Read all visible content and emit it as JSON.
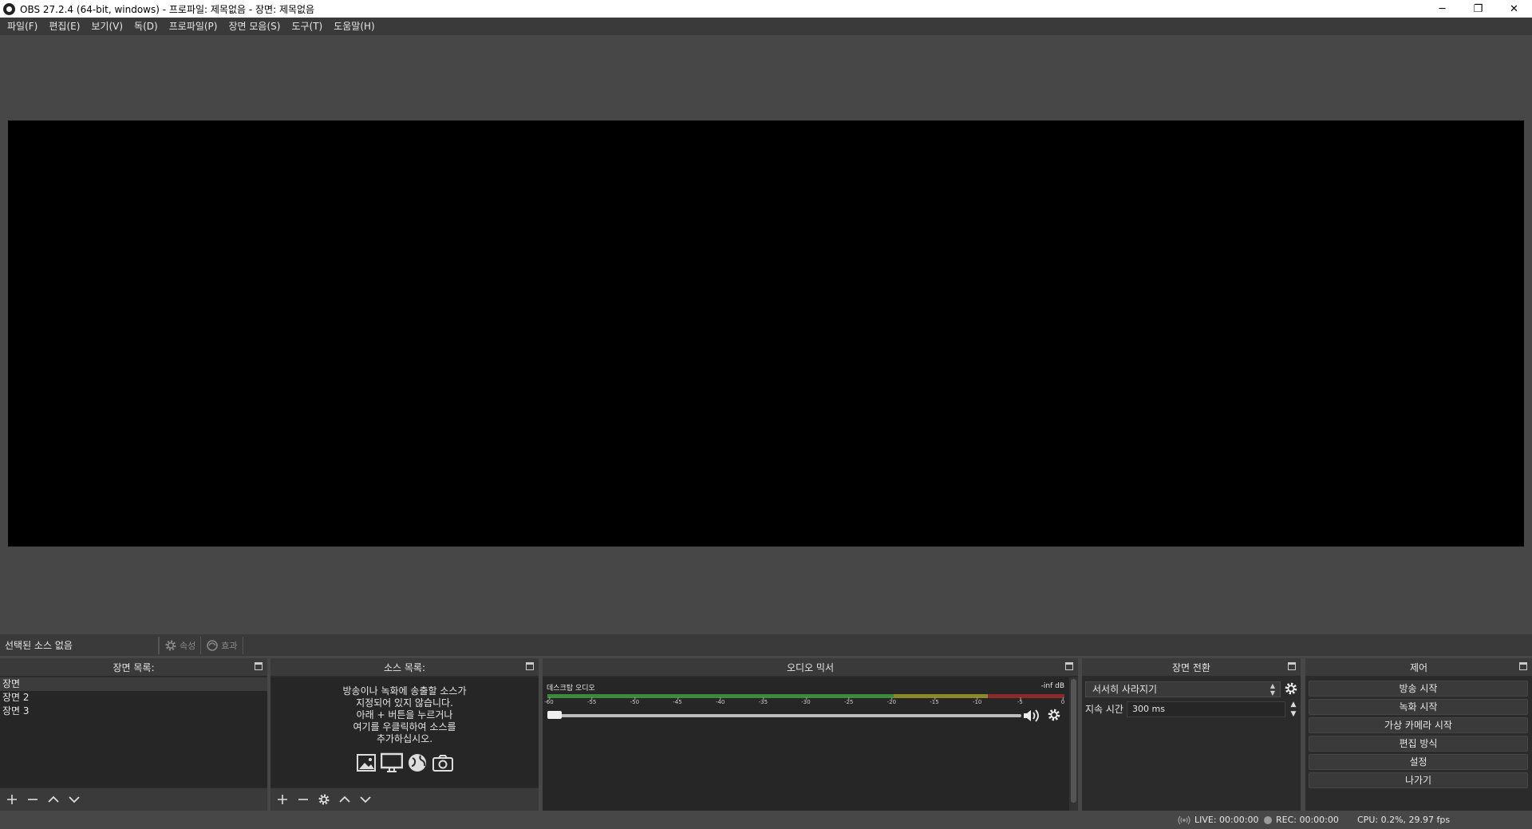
{
  "window": {
    "title": "OBS 27.2.4 (64-bit, windows) - 프로파일: 제목없음 - 장면: 제목없음",
    "minimize": "─",
    "restore": "❐",
    "close": "✕"
  },
  "menubar": {
    "items": [
      "파일(F)",
      "편집(E)",
      "보기(V)",
      "독(D)",
      "프로파일(P)",
      "장면 모음(S)",
      "도구(T)",
      "도움말(H)"
    ]
  },
  "context_bar": {
    "no_source": "선택된 소스 없음",
    "properties_label": "속성",
    "filters_label": "효과"
  },
  "scenes": {
    "title": "장면 목록:",
    "items": [
      "장면",
      "장면 2",
      "장면 3"
    ],
    "selected_index": 0
  },
  "sources": {
    "title": "소스 목록:",
    "empty_hint": [
      "방송이나 녹화에 송출할 소스가",
      "지정되어 있지 않습니다.",
      "아래 + 버튼을 누르거나",
      "여기를 우클릭하여 소스를",
      "추가하십시오."
    ]
  },
  "mixer": {
    "title": "오디오 믹서",
    "channel_name": "데스크탑 오디오",
    "db_readout": "-inf dB",
    "ticks": [
      "-60",
      "-55",
      "-50",
      "-45",
      "-40",
      "-35",
      "-30",
      "-25",
      "-20",
      "-15",
      "-10",
      "-5",
      "0"
    ],
    "volume_fraction": 0.0
  },
  "transitions": {
    "title": "장면 전환",
    "selected": "서서히 사라지기",
    "duration_label": "지속 시간",
    "duration_value": "300 ms"
  },
  "controls": {
    "title": "제어",
    "buttons": [
      "방송 시작",
      "녹화 시작",
      "가상 카메라 시작",
      "편집 방식",
      "설정",
      "나가기"
    ]
  },
  "status": {
    "live": "LIVE: 00:00:00",
    "rec": "REC: 00:00:00",
    "cpu": "CPU: 0.2%, 29.97 fps"
  },
  "colors": {
    "background": "#474747",
    "dock": "#2b2b2b",
    "meter_green": "#3c8a3c",
    "meter_yellow": "#8a8a2a",
    "meter_red": "#8a2a2a"
  }
}
